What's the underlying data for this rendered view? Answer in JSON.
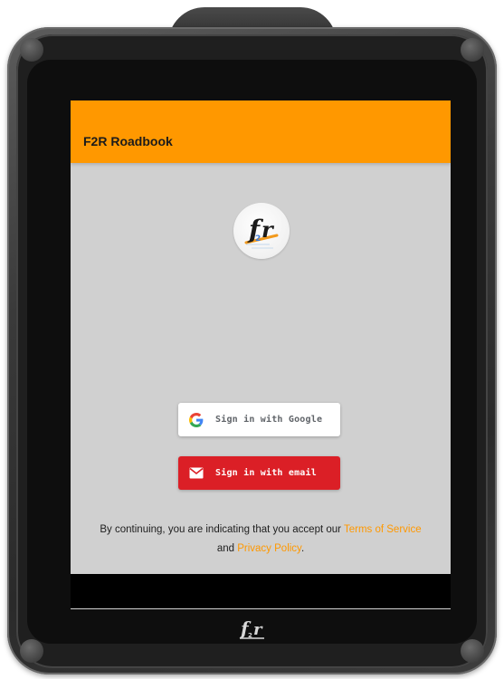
{
  "app_bar": {
    "title": "F2R Roadbook",
    "background_color": "#ff9800"
  },
  "logo": {
    "icon": "f2r-logo-icon"
  },
  "buttons": {
    "google": {
      "label": "Sign in with Google",
      "icon": "google-g-icon"
    },
    "email": {
      "label": "Sign in with email",
      "icon": "mail-icon",
      "background_color": "#db1f26"
    }
  },
  "terms": {
    "prefix": "By continuing, you are indicating that you accept our ",
    "terms_link": "Terms of Service",
    "middle": "and ",
    "privacy_link": "Privacy Policy",
    "suffix": ".",
    "link_color": "#ff9800"
  },
  "device": {
    "bottom_brand_icon": "f2r-brand-icon"
  }
}
